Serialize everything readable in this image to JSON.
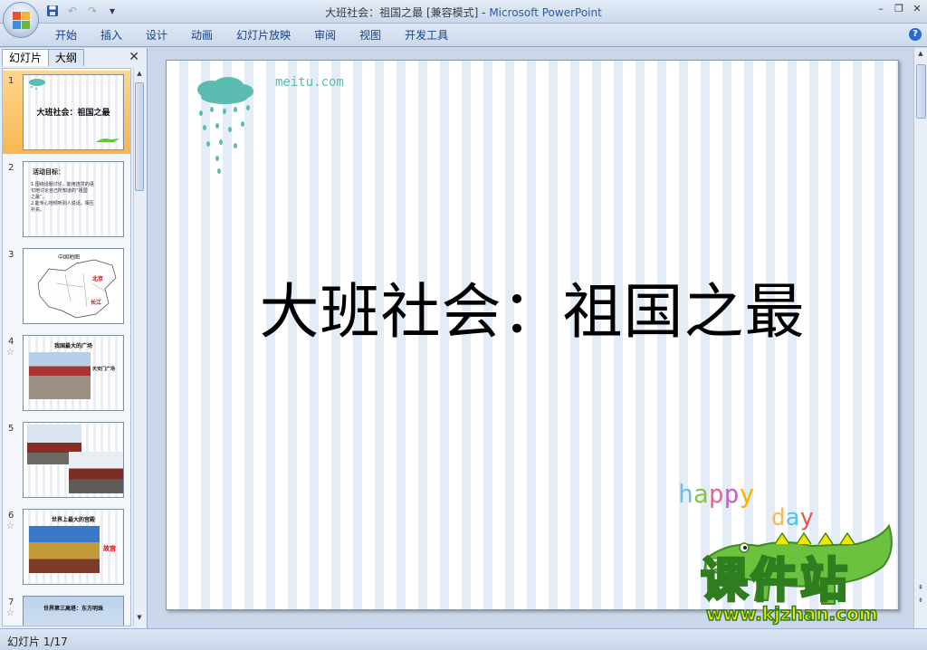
{
  "window": {
    "title_prefix": "大班社会：祖国之最 [兼容模式] - ",
    "app_name": "Microsoft PowerPoint",
    "minimize": "–",
    "restore": "❐",
    "close": "✕"
  },
  "ribbon": {
    "tabs": [
      "开始",
      "插入",
      "设计",
      "动画",
      "幻灯片放映",
      "审阅",
      "视图",
      "开发工具"
    ],
    "help": "?"
  },
  "panel": {
    "tabs": [
      "幻灯片",
      "大纲"
    ],
    "close": "✕"
  },
  "thumbnails": [
    {
      "num": "1",
      "title": "大班社会：祖国之最",
      "selected": true
    },
    {
      "num": "2",
      "title": "活动目标：",
      "lines": [
        "1.围绕话题讨论，能用连贯的语",
        "句地讨论自己所知道的“祖国",
        "之最”。",
        "2.能专心地倾听别人说话，相互",
        "补充。"
      ]
    },
    {
      "num": "3",
      "title": "中国地图",
      "labels": [
        "北京",
        "长江"
      ]
    },
    {
      "num": "4",
      "title": "我国最大的广场",
      "caption": "天安门广场",
      "highlight": "最大"
    },
    {
      "num": "5"
    },
    {
      "num": "6",
      "title": "世界上最大的宫殿",
      "caption": "故宫",
      "highlight": "最大"
    },
    {
      "num": "7",
      "title": "世界第三高塔：东方明珠",
      "highlight": "第三"
    }
  ],
  "slide": {
    "title": "大班社会：祖国之最",
    "logo_text": "meitu.com",
    "happy_letters": [
      "h",
      "a",
      "p",
      "p",
      "y"
    ],
    "day_letters": [
      "d",
      "a",
      "y"
    ]
  },
  "watermark": {
    "big": "课件站",
    "url": "www.kjzhan.com"
  },
  "status": {
    "text": "幻灯片 1/17"
  },
  "colors": {
    "accent_blue": "#15428b",
    "selection": "#f8b650",
    "cloud": "#5bbcb1",
    "crocodile": "#6cc23e",
    "highlight_red": "#e60000"
  },
  "icons": [
    "office-logo-icon",
    "save-icon",
    "undo-icon",
    "redo-icon",
    "qat-dropdown-icon",
    "help-icon",
    "close-icon",
    "cloud-icon",
    "crocodile-icon"
  ]
}
